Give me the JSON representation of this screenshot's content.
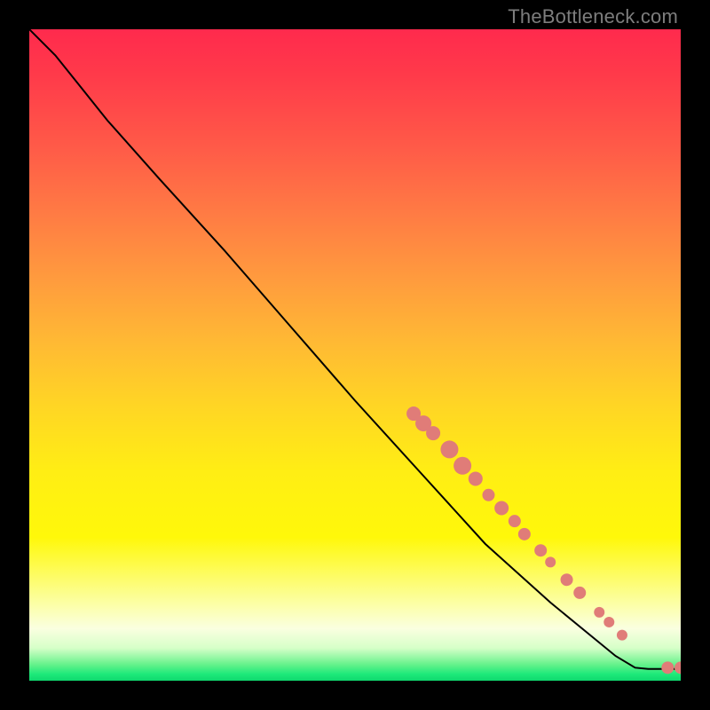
{
  "watermark": "TheBottleneck.com",
  "colors": {
    "point_fill": "#e07c78",
    "curve_stroke": "#000000"
  },
  "chart_data": {
    "type": "line",
    "title": "",
    "xlabel": "",
    "ylabel": "",
    "xlim": [
      0,
      100
    ],
    "ylim": [
      0,
      100
    ],
    "curve": [
      {
        "x": 0.0,
        "y": 100.0
      },
      {
        "x": 4.0,
        "y": 96.0
      },
      {
        "x": 8.0,
        "y": 91.0
      },
      {
        "x": 12.0,
        "y": 86.0
      },
      {
        "x": 20.0,
        "y": 77.0
      },
      {
        "x": 30.0,
        "y": 66.0
      },
      {
        "x": 40.0,
        "y": 54.5
      },
      {
        "x": 50.0,
        "y": 43.0
      },
      {
        "x": 60.0,
        "y": 32.0
      },
      {
        "x": 70.0,
        "y": 21.0
      },
      {
        "x": 80.0,
        "y": 12.0
      },
      {
        "x": 90.0,
        "y": 3.8
      },
      {
        "x": 93.0,
        "y": 2.0
      },
      {
        "x": 95.0,
        "y": 1.8
      },
      {
        "x": 100.0,
        "y": 1.8
      }
    ],
    "points": [
      {
        "x": 59.0,
        "y": 41.0,
        "r": 8
      },
      {
        "x": 60.5,
        "y": 39.5,
        "r": 9
      },
      {
        "x": 62.0,
        "y": 38.0,
        "r": 8
      },
      {
        "x": 64.5,
        "y": 35.5,
        "r": 10
      },
      {
        "x": 66.5,
        "y": 33.0,
        "r": 10
      },
      {
        "x": 68.5,
        "y": 31.0,
        "r": 8
      },
      {
        "x": 70.5,
        "y": 28.5,
        "r": 7
      },
      {
        "x": 72.5,
        "y": 26.5,
        "r": 8
      },
      {
        "x": 74.5,
        "y": 24.5,
        "r": 7
      },
      {
        "x": 76.0,
        "y": 22.5,
        "r": 7
      },
      {
        "x": 78.5,
        "y": 20.0,
        "r": 7
      },
      {
        "x": 80.0,
        "y": 18.2,
        "r": 6
      },
      {
        "x": 82.5,
        "y": 15.5,
        "r": 7
      },
      {
        "x": 84.5,
        "y": 13.5,
        "r": 7
      },
      {
        "x": 87.5,
        "y": 10.5,
        "r": 6
      },
      {
        "x": 89.0,
        "y": 9.0,
        "r": 6
      },
      {
        "x": 91.0,
        "y": 7.0,
        "r": 6
      },
      {
        "x": 98.0,
        "y": 2.0,
        "r": 7
      },
      {
        "x": 100.0,
        "y": 2.0,
        "r": 7
      }
    ]
  }
}
